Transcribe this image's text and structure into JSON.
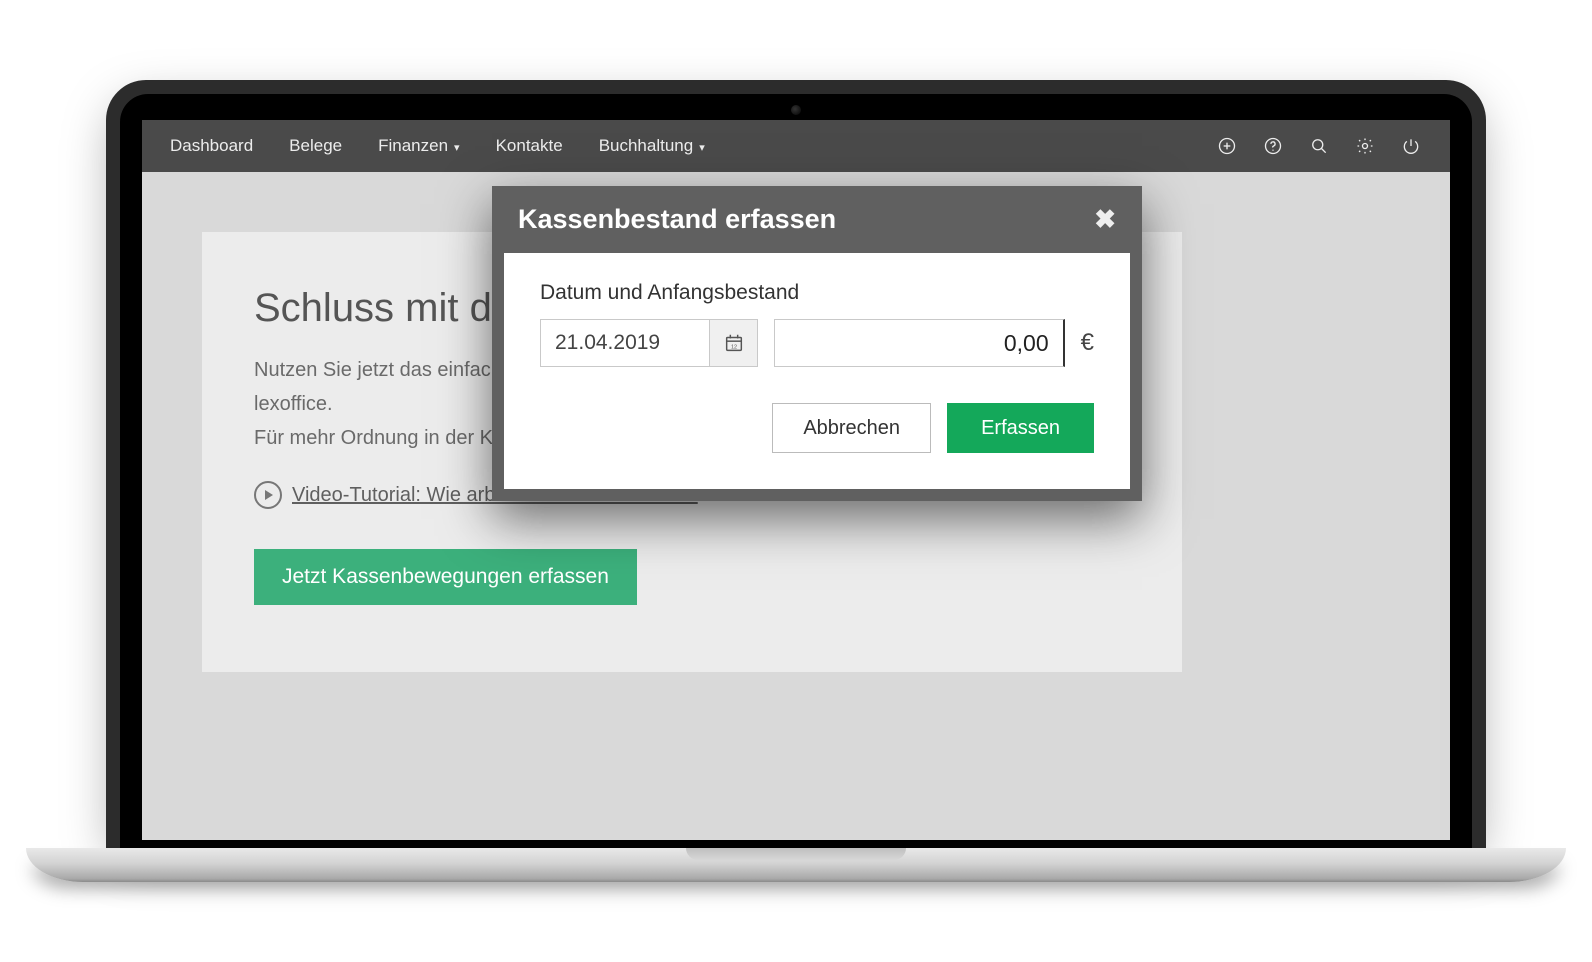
{
  "nav": {
    "items": [
      "Dashboard",
      "Belege",
      "Finanzen",
      "Kontakte",
      "Buchhaltung"
    ],
    "dropdown_indices": [
      2,
      4
    ]
  },
  "panel": {
    "heading": "Schluss mit der",
    "desc_line1": "Nutzen Sie jetzt das einfache",
    "desc_line2": "lexoffice.",
    "desc_line3": "Für mehr Ordnung in der Kas",
    "tutorial_link": " Video-Tutorial: Wie arbeite ich mit der Kasse?",
    "cta": "Jetzt Kassenbewegungen erfassen"
  },
  "modal": {
    "title": "Kassenbestand erfassen",
    "section_label": "Datum und Anfangsbestand",
    "date_value": "21.04.2019",
    "amount_value": "0,00",
    "currency": "€",
    "cancel": "Abbrechen",
    "submit": "Erfassen"
  }
}
